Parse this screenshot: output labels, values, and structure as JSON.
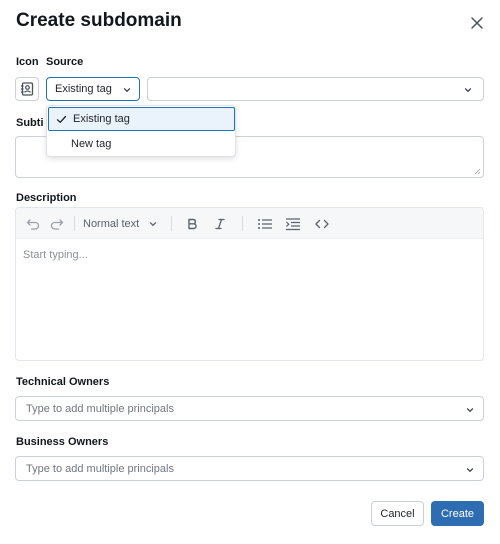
{
  "dialog": {
    "title": "Create subdomain"
  },
  "fields": {
    "icon_label": "Icon",
    "source_label": "Source",
    "source_value": "Existing tag",
    "tag_value": "",
    "subtitle_label": "Subtitle",
    "subtitle_visible": "Subti",
    "description_label": "Description",
    "description_placeholder": "Start typing...",
    "technical_owners_label": "Technical Owners",
    "technical_owners_placeholder": "Type to add multiple principals",
    "business_owners_label": "Business Owners",
    "business_owners_placeholder": "Type to add multiple principals"
  },
  "editor_toolbar": {
    "text_style": "Normal text"
  },
  "source_dropdown": {
    "options": [
      {
        "label": "Existing tag",
        "selected": true
      },
      {
        "label": "New tag",
        "selected": false
      }
    ]
  },
  "footer": {
    "cancel_label": "Cancel",
    "create_label": "Create"
  },
  "colors": {
    "primary": "#2f6db3",
    "focus_border": "#2272b4",
    "selected_bg": "#eaf3fb",
    "border": "#cbd1d7"
  },
  "icons": {
    "close": "close-icon",
    "icon_picker": "contact-book-icon",
    "chevron": "chevron-down-icon",
    "check": "check-icon",
    "undo": "undo-icon",
    "redo": "redo-icon",
    "bold": "bold-icon",
    "italic": "italic-icon",
    "bullet_list": "bullet-list-icon",
    "quote": "quote-icon",
    "code": "code-icon"
  }
}
